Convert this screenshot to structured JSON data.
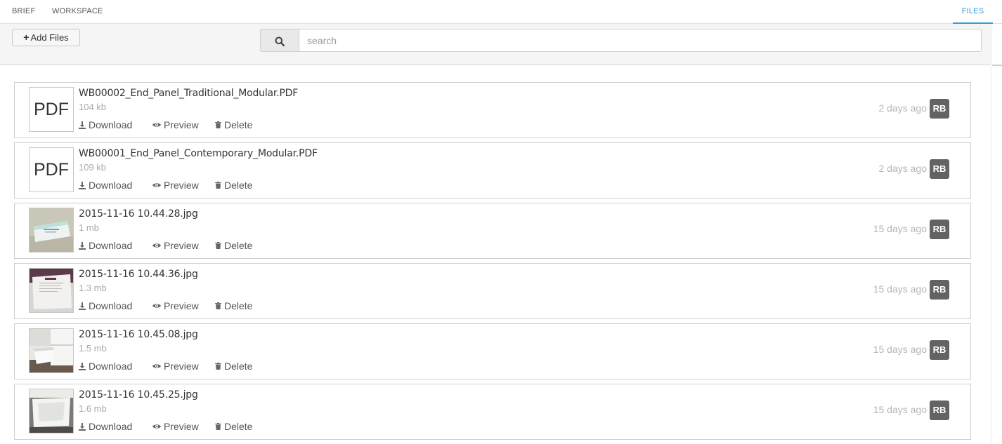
{
  "tabs": {
    "brief": "BRIEF",
    "workspace": "WORKSPACE",
    "files": "FILES"
  },
  "toolbar": {
    "add_files_label": "Add Files",
    "search_placeholder": "search"
  },
  "actions": {
    "download": "Download",
    "preview": "Preview",
    "delete": "Delete"
  },
  "files": [
    {
      "name": "WB00002_End_Panel_Traditional_Modular.PDF",
      "size": "104 kb",
      "ago": "2 days ago",
      "user": "RB",
      "thumb": "PDF"
    },
    {
      "name": "WB00001_End_Panel_Contemporary_Modular.PDF",
      "size": "109 kb",
      "ago": "2 days ago",
      "user": "RB",
      "thumb": "PDF"
    },
    {
      "name": "2015-11-16 10.44.28.jpg",
      "size": "1 mb",
      "ago": "15 days ago",
      "user": "RB",
      "thumb": "photo-box"
    },
    {
      "name": "2015-11-16 10.44.36.jpg",
      "size": "1.3 mb",
      "ago": "15 days ago",
      "user": "RB",
      "thumb": "photo-sign"
    },
    {
      "name": "2015-11-16 10.45.08.jpg",
      "size": "1.5 mb",
      "ago": "15 days ago",
      "user": "RB",
      "thumb": "photo-drawer-open"
    },
    {
      "name": "2015-11-16 10.45.25.jpg",
      "size": "1.6 mb",
      "ago": "15 days ago",
      "user": "RB",
      "thumb": "photo-drawer"
    }
  ],
  "colors": {
    "accent": "#3a9ad9",
    "avatar_bg": "#636363",
    "muted": "#aaaaaa"
  }
}
